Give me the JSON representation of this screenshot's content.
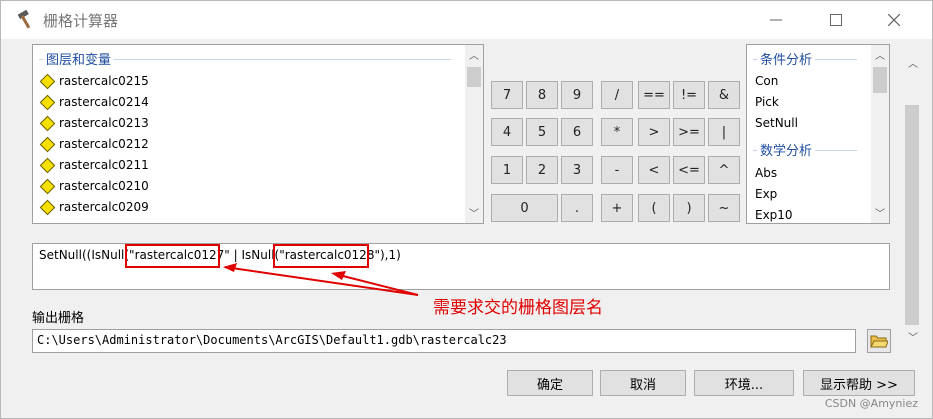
{
  "window": {
    "title": "栅格计算器"
  },
  "layers": {
    "group_title": "图层和变量",
    "items": [
      "rastercalc0215",
      "rastercalc0214",
      "rastercalc0213",
      "rastercalc0212",
      "rastercalc0211",
      "rastercalc0210",
      "rastercalc0209"
    ]
  },
  "keypad": {
    "row1": [
      "7",
      "8",
      "9",
      "/",
      "==",
      "!=",
      "&"
    ],
    "row2": [
      "4",
      "5",
      "6",
      "*",
      ">",
      ">=",
      "|"
    ],
    "row3": [
      "1",
      "2",
      "3",
      "-",
      "<",
      "<=",
      "^"
    ],
    "row4": [
      "0",
      ".",
      "+",
      "(",
      ")",
      "~"
    ]
  },
  "functions": {
    "group1_title": "条件分析",
    "group1_items": [
      "Con",
      "Pick",
      "SetNull"
    ],
    "group2_title": "数学分析",
    "group2_items": [
      "Abs",
      "Exp",
      "Exp10"
    ]
  },
  "expression": {
    "part1": "SetNull((IsNull(\"",
    "layer1": "rastercalc0127\"",
    "part2": " | IsNull(\"",
    "layer2": "rastercalc0128\"",
    "part3": "),1)"
  },
  "annotation": "需要求交的栅格图层名",
  "output": {
    "label": "输出栅格",
    "value": "C:\\Users\\Administrator\\Documents\\ArcGIS\\Default1.gdb\\rastercalc23"
  },
  "buttons": {
    "ok": "确定",
    "cancel": "取消",
    "environments": "环境...",
    "show_help": "显示帮助 >>"
  },
  "watermark": "CSDN @Amyniez",
  "colors": {
    "highlight": "#e00000",
    "group_title": "#1f4fa0",
    "layer_icon": "#f5e000"
  }
}
